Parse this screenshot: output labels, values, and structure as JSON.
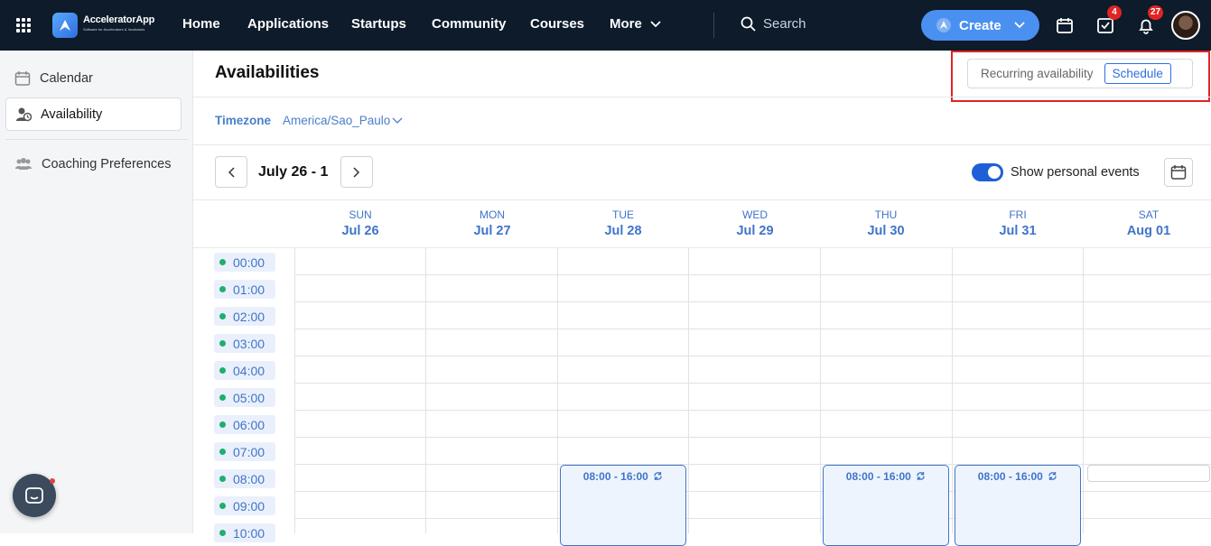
{
  "topbar": {
    "brand_name": "AcceleratorApp",
    "brand_tagline": "Software for Accelerators & Incubators",
    "nav": [
      "Home",
      "Applications",
      "Startups",
      "Community",
      "Courses",
      "More"
    ],
    "search_label": "Search",
    "create_label": "Create",
    "tasks_badge": "4",
    "notifications_badge": "27",
    "icons": [
      "apps-grid-icon",
      "calendar-icon",
      "tasks-icon",
      "bell-icon",
      "chevron-down-icon",
      "search-icon"
    ]
  },
  "sidebar": {
    "items": [
      {
        "label": "Calendar",
        "icon": "calendar-icon"
      },
      {
        "label": "Availability",
        "icon": "availability-icon"
      },
      {
        "label": "Coaching Preferences",
        "icon": "people-icon"
      }
    ]
  },
  "main": {
    "title": "Availabilities",
    "tab_recurring": "Recurring availability",
    "tab_schedule": "Schedule",
    "timezone_label": "Timezone",
    "timezone_value": "America/Sao_Paulo",
    "range": "July 26 - 1",
    "toggle_label": "Show personal events",
    "toggle_on": true
  },
  "calendar": {
    "days": [
      {
        "name": "SUN",
        "date": "Jul 26"
      },
      {
        "name": "MON",
        "date": "Jul 27"
      },
      {
        "name": "TUE",
        "date": "Jul 28"
      },
      {
        "name": "WED",
        "date": "Jul 29"
      },
      {
        "name": "THU",
        "date": "Jul 30"
      },
      {
        "name": "FRI",
        "date": "Jul 31"
      },
      {
        "name": "SAT",
        "date": "Aug 01"
      }
    ],
    "times": [
      "00:00",
      "01:00",
      "02:00",
      "03:00",
      "04:00",
      "05:00",
      "06:00",
      "07:00",
      "08:00",
      "09:00",
      "10:00"
    ],
    "events": [
      {
        "day": "TUE",
        "label": "08:00 - 16:00"
      },
      {
        "day": "THU",
        "label": "08:00 - 16:00"
      },
      {
        "day": "FRI",
        "label": "08:00 - 16:00"
      }
    ]
  },
  "colors": {
    "navbar": "#0d1b2a",
    "accent": "#3f74c9",
    "create_button": "#4a90f0",
    "highlight": "#e02424",
    "available_dot": "#1fae6e"
  }
}
